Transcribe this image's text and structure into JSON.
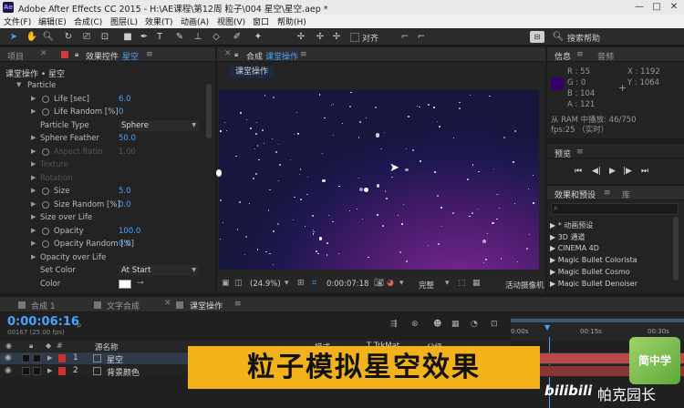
{
  "window": {
    "app_icon": "Ae",
    "title": "Adobe After Effects CC 2015 - H:\\AE课程\\第12周 粒子\\004 星空\\星空.aep *",
    "controls": [
      "—",
      "□",
      "✕"
    ]
  },
  "menu": [
    "文件(F)",
    "编辑(E)",
    "合成(C)",
    "图层(L)",
    "效果(T)",
    "动画(A)",
    "视图(V)",
    "窗口",
    "帮助(H)"
  ],
  "toolbar": {
    "align_label": "对齐",
    "search_help": "搜索帮助"
  },
  "left_panel": {
    "tab_project": "项目",
    "tab_effects": "效果控件",
    "tab_effects_layer": "星空",
    "breadcrumb": "课堂操作 • 星空",
    "rows": [
      {
        "label": "Particle",
        "value": "",
        "indent": 0,
        "type": "group",
        "dim": false
      },
      {
        "label": "Life [sec]",
        "value": "6.0",
        "indent": 1,
        "type": "stopwatch",
        "dim": false
      },
      {
        "label": "Life Random [%]",
        "value": "0",
        "indent": 1,
        "type": "stopwatch",
        "dim": false
      },
      {
        "label": "Particle Type",
        "value": "Sphere",
        "indent": 1,
        "type": "dropdown",
        "dim": false
      },
      {
        "label": "Sphere Feather",
        "value": "50.0",
        "indent": 1,
        "type": "tri",
        "dim": false
      },
      {
        "label": "Aspect Ratio",
        "value": "1.00",
        "indent": 1,
        "type": "stopwatch",
        "dim": true
      },
      {
        "label": "Texture",
        "value": "",
        "indent": 1,
        "type": "tri",
        "dim": true
      },
      {
        "label": "Rotation",
        "value": "",
        "indent": 1,
        "type": "tri",
        "dim": true
      },
      {
        "label": "Size",
        "value": "5.0",
        "indent": 1,
        "type": "stopwatch",
        "dim": false
      },
      {
        "label": "Size Random [%]",
        "value": "0.0",
        "indent": 1,
        "type": "stopwatch",
        "dim": false
      },
      {
        "label": "Size over Life",
        "value": "",
        "indent": 1,
        "type": "tri",
        "dim": false
      },
      {
        "label": "Opacity",
        "value": "100.0",
        "indent": 1,
        "type": "stopwatch",
        "dim": false
      },
      {
        "label": "Opacity Random [%]",
        "value": "0.0",
        "indent": 1,
        "type": "stopwatch",
        "dim": false
      },
      {
        "label": "Opacity over Life",
        "value": "",
        "indent": 1,
        "type": "tri",
        "dim": false
      },
      {
        "label": "Set Color",
        "value": "At Start",
        "indent": 1,
        "type": "dropdown",
        "dim": false
      },
      {
        "label": "Color",
        "value": "",
        "indent": 1,
        "type": "color",
        "dim": false
      }
    ]
  },
  "comp_panel": {
    "tab_label": "合成",
    "tab_comp": "课堂操作",
    "comp_button": "课堂操作",
    "zoom": "(24.9%)",
    "timecode": "0:00:07:18",
    "quality": "完整",
    "camera": "活动摄像机"
  },
  "info_panel": {
    "tab_info": "信息",
    "tab_audio": "音频",
    "swatch_color": "#370068",
    "r": "R : 55",
    "g": "G : 0",
    "b": "B : 104",
    "a": "A : 121",
    "x": "X : 1192",
    "y": "Y : 1064",
    "ram_line": "从 RAM 中播放: 46/750",
    "fps_line": "fps:25 （实时）"
  },
  "preview_panel": {
    "tab": "预览"
  },
  "effects_panel": {
    "tab_effects": "效果和预设",
    "tab_library": "库",
    "items": [
      "▶ * 动画预设",
      "▶ 3D 通道",
      "▶ CINEMA 4D",
      "▶ Magic Bullet Colorista",
      "▶ Magic Bullet Cosmo",
      "▶ Magic Bullet Denoiser"
    ]
  },
  "timeline": {
    "tabs": [
      "合成 1",
      "文字合成",
      "课堂操作"
    ],
    "timecode": "0:00:06:16",
    "frame_info": "00167 (25.00 fps)",
    "col_name": "源名称",
    "col_mode": "模式",
    "col_trkmat": "T  TrkMat",
    "col_parent": "父级",
    "ruler": [
      "0:00s",
      "00:15s",
      "00:30s"
    ],
    "layers": [
      {
        "num": "1",
        "name": "星空",
        "color": "#c83232"
      },
      {
        "num": "2",
        "name": "背景颜色",
        "color": "#c83232"
      }
    ]
  },
  "overlay": {
    "banner": "粒子模拟星空效果",
    "watermark": "帕克园长",
    "bilibili": "bilibili",
    "badge": "简中学"
  }
}
